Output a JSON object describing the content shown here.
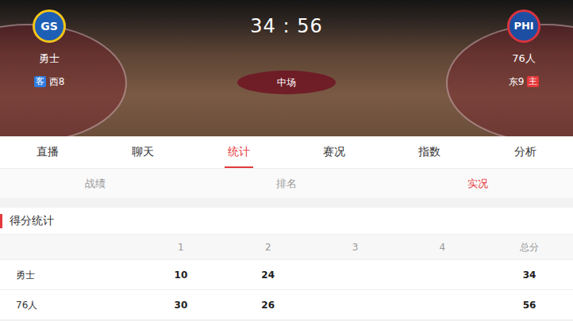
{
  "header": {
    "away": {
      "logo": "GS",
      "name": "勇士",
      "tag": "客",
      "rank": "西8"
    },
    "home": {
      "logo": "PHI",
      "name": "76人",
      "rank": "东9",
      "tag": "主"
    },
    "score": "34 : 56",
    "status": "中场"
  },
  "tabs": [
    {
      "label": "直播",
      "selected": false
    },
    {
      "label": "聊天",
      "selected": false
    },
    {
      "label": "统计",
      "selected": true
    },
    {
      "label": "赛况",
      "selected": false
    },
    {
      "label": "指数",
      "selected": false
    },
    {
      "label": "分析",
      "selected": false
    }
  ],
  "subtabs": [
    {
      "label": "战绩",
      "selected": false
    },
    {
      "label": "排名",
      "selected": false
    },
    {
      "label": "实况",
      "selected": true
    }
  ],
  "section": {
    "title": "得分统计"
  },
  "table": {
    "columns": [
      "1",
      "2",
      "3",
      "4",
      "总分"
    ],
    "rows": [
      {
        "team": "勇士",
        "quarters": [
          "10",
          "24"
        ],
        "total": "34"
      },
      {
        "team": "76人",
        "quarters": [
          "30",
          "26"
        ],
        "total": "56"
      }
    ]
  }
}
